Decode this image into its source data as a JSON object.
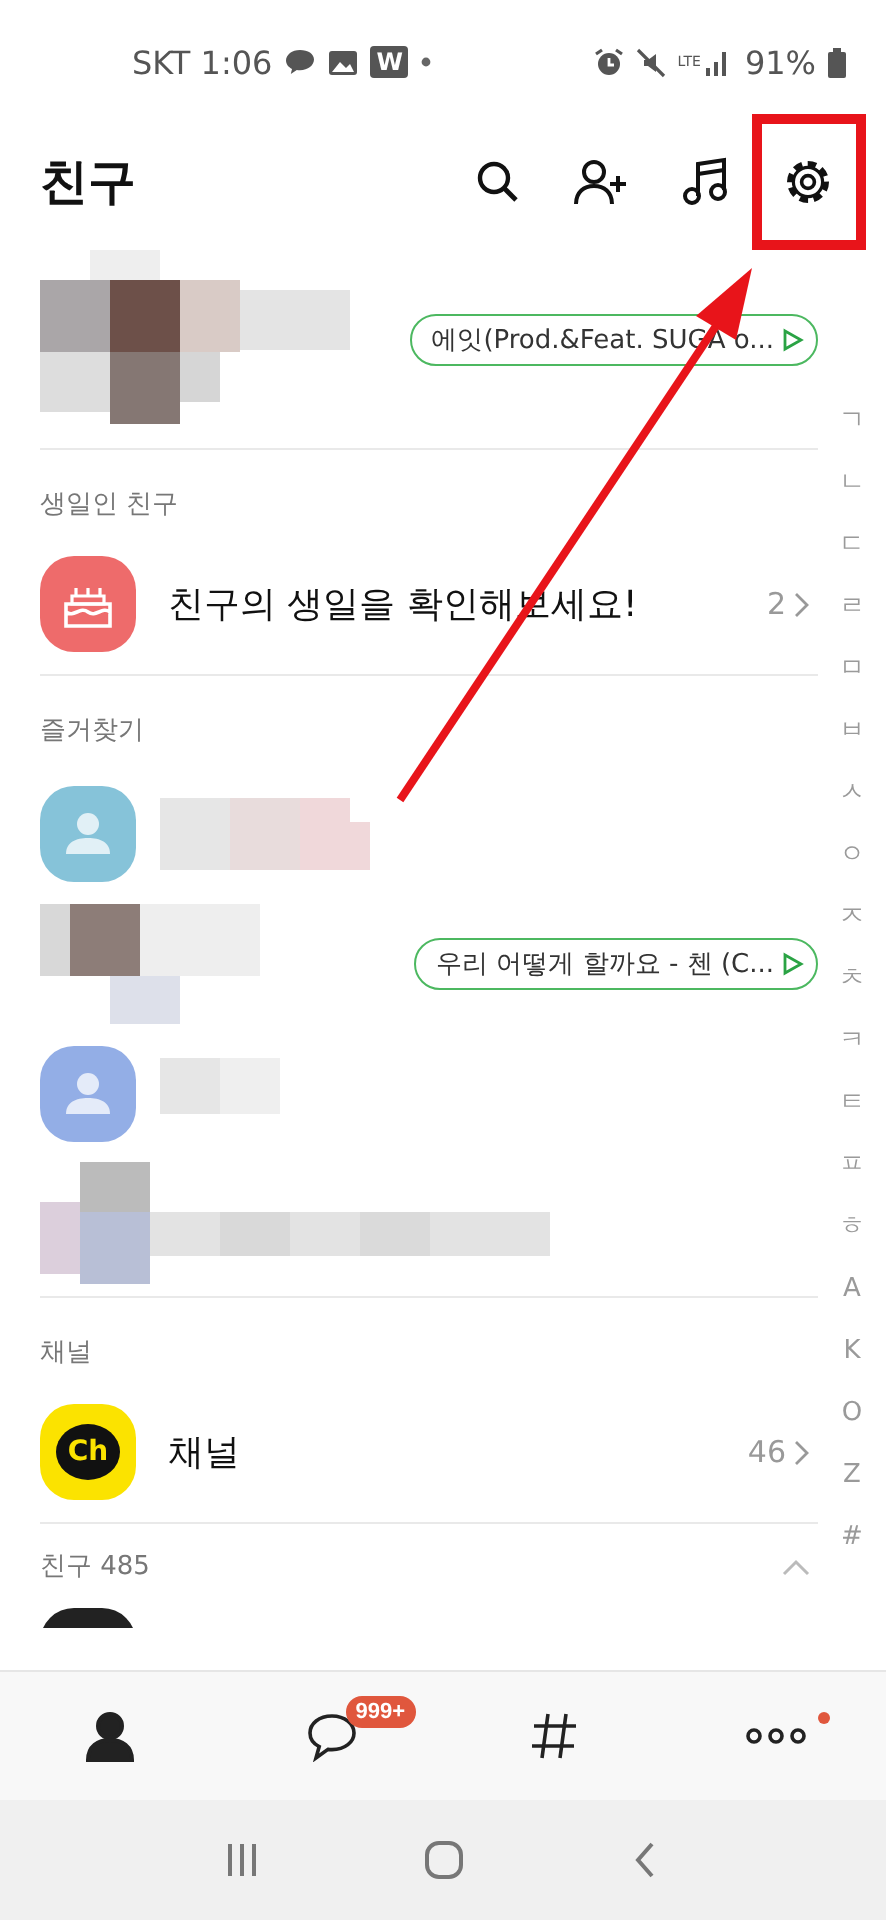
{
  "status_bar": {
    "carrier_time": "SKT 1:06",
    "app_letter": "W",
    "network": "LTE",
    "battery": "91%"
  },
  "header": {
    "title": "친구"
  },
  "profile": {
    "music": "에잇(Prod.&Feat. SUGA o..."
  },
  "birthday": {
    "header": "생일인 친구",
    "label": "친구의 생일을 확인해보세요!",
    "count": "2"
  },
  "favorites": {
    "header": "즐거찾기",
    "friends": [
      {
        "kind": "default",
        "color": "#86c3d9"
      },
      {
        "kind": "photo",
        "music": "우리 어떻게 할까요 - 첸 (C..."
      },
      {
        "kind": "default",
        "color": "#93aee6"
      },
      {
        "kind": "photo"
      }
    ]
  },
  "channel": {
    "header": "채널",
    "logo": "Ch",
    "label": "채널",
    "count": "46"
  },
  "friends": {
    "header": "친구 485",
    "expanded": true
  },
  "index": [
    "ㄱ",
    "ㄴ",
    "ㄷ",
    "ㄹ",
    "ㅁ",
    "ㅂ",
    "ㅅ",
    "ㅇ",
    "ㅈ",
    "ㅊ",
    "ㅋ",
    "ㅌ",
    "ㅍ",
    "ㅎ",
    "A",
    "K",
    "O",
    "Z",
    "#"
  ],
  "bottom_nav": [
    {
      "kind": "friends",
      "selected": true
    },
    {
      "kind": "chats",
      "selected": false,
      "badge": "999+"
    },
    {
      "kind": "open",
      "selected": false
    },
    {
      "kind": "more",
      "selected": false,
      "dot": true
    }
  ]
}
